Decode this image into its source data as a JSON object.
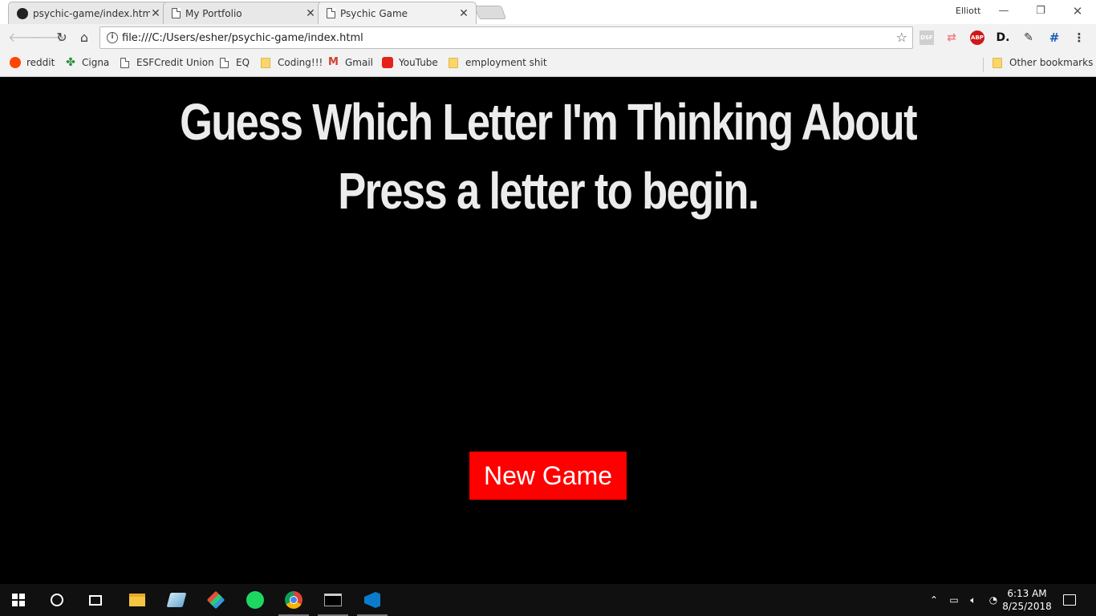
{
  "browser": {
    "tabs": [
      {
        "title": "psychic-game/index.html",
        "icon": "github-icon",
        "active": false
      },
      {
        "title": "My Portfolio",
        "icon": "page-icon",
        "active": false
      },
      {
        "title": "Psychic Game",
        "icon": "page-icon",
        "active": true
      }
    ],
    "profile_name": "Elliott",
    "url": "file:///C:/Users/esher/psychic-game/index.html",
    "bookmarks": [
      {
        "label": "reddit",
        "icon": "reddit-icon"
      },
      {
        "label": "Cigna",
        "icon": "cigna-icon"
      },
      {
        "label": "ESFCredit Union",
        "icon": "page-icon"
      },
      {
        "label": "EQ",
        "icon": "page-icon"
      },
      {
        "label": "Coding!!!",
        "icon": "folder-icon"
      },
      {
        "label": "Gmail",
        "icon": "gmail-icon"
      },
      {
        "label": "YouTube",
        "icon": "youtube-icon"
      },
      {
        "label": "employment shit",
        "icon": "folder-icon"
      }
    ],
    "other_bookmarks": "Other bookmarks",
    "extensions": [
      "dsf-extension-icon",
      "cast-icon",
      "adblock-plus-icon",
      "dashlane-icon",
      "color-picker-icon",
      "page-ruler-icon"
    ],
    "extension_labels": {
      "adblock": "ABP",
      "dashlane": "D."
    }
  },
  "page": {
    "title_line1": "Guess Which Letter I'm Thinking About",
    "title_line2": "Press a letter to begin.",
    "new_game_label": "New Game",
    "accent_color": "#ff0000"
  },
  "taskbar": {
    "apps": [
      "start-icon",
      "cortana-icon",
      "task-view-icon",
      "file-explorer-icon",
      "app-icon",
      "git-icon",
      "spotify-icon",
      "chrome-icon",
      "terminal-icon",
      "vscode-icon"
    ],
    "time": "6:13 AM",
    "date": "8/25/2018"
  }
}
